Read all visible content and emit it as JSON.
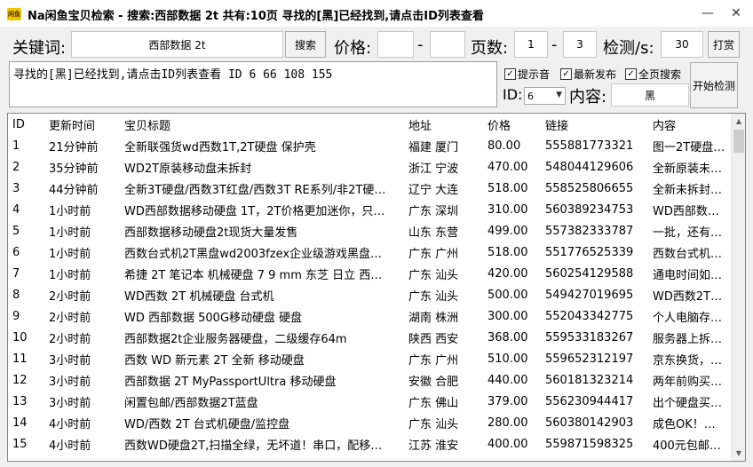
{
  "window": {
    "icon_label": "闲鱼",
    "title": "Na闲鱼宝贝检索 - 搜索:西部数据 2t 共有:10页 寻找的[黑]已经找到,请点击ID列表查看",
    "minimize_glyph": "—",
    "close_glyph": "✕"
  },
  "toolbar": {
    "keyword_label": "关键词:",
    "keyword_value": "西部数据 2t",
    "search_button": "搜索",
    "price_label": "价格:",
    "price_min": "",
    "price_dash": "-",
    "price_max": "",
    "pages_label": "页数:",
    "page_from": "1",
    "page_dash": "-",
    "page_to": "3",
    "interval_label": "检测/s:",
    "interval_value": "30",
    "reward_button": "打赏"
  },
  "message": "寻找的[黑]已经找到,请点击ID列表查看 ID 6 66 108 155",
  "options": {
    "sound": {
      "label": "提示音",
      "checked": true
    },
    "latest": {
      "label": "最新发布",
      "checked": true
    },
    "all_pages": {
      "label": "全页搜索",
      "checked": true
    }
  },
  "id_select": {
    "label": "ID:",
    "value": "6"
  },
  "content_filter": {
    "label": "内容:",
    "value": "黑"
  },
  "start_button": "开始检测",
  "table": {
    "headers": [
      "ID",
      "更新时间",
      "宝贝标题",
      "地址",
      "价格",
      "链接",
      "内容"
    ],
    "rows": [
      [
        "1",
        "21分钟前",
        "全新联强货wd西数1T,2T硬盘 保护壳",
        "福建 厦门",
        "80.00",
        "555881773321",
        "图一2T硬盘…"
      ],
      [
        "2",
        "35分钟前",
        "WD2T原装移动盘未拆封",
        "浙江 宁波",
        "470.00",
        "548044129606",
        "全新原装未…"
      ],
      [
        "3",
        "44分钟前",
        "全新3T硬盘/西数3T红盘/西数3T RE系列/非2T硬…",
        "辽宁 大连",
        "518.00",
        "558525806655",
        "全新未拆封…"
      ],
      [
        "4",
        "1小时前",
        "WD西部数据移动硬盘 1T，2T价格更加迷你，只…",
        "广东 深圳",
        "310.00",
        "560389234753",
        "WD西部数…"
      ],
      [
        "5",
        "1小时前",
        "西部数据移动硬盘2t现货大量发售",
        "山东 东营",
        "499.00",
        "557382333787",
        "一批，还有…"
      ],
      [
        "6",
        "1小时前",
        "西数台式机2T黑盘wd2003fzex企业级游戏黑盘…",
        "广东 广州",
        "518.00",
        "551776525339",
        "西数台式机…"
      ],
      [
        "7",
        "1小时前",
        "希捷 2T 笔记本 机械硬盘 7 9 mm 东芝 日立 西…",
        "广东 汕头",
        "420.00",
        "560254129588",
        "通电时间如…"
      ],
      [
        "8",
        "2小时前",
        "WD西数 2T 机械硬盘 台式机",
        "广东 汕头",
        "500.00",
        "549427019695",
        "WD西数2T…"
      ],
      [
        "9",
        "2小时前",
        "WD 西部数据 500G移动硬盘 硬盘",
        "湖南 株洲",
        "300.00",
        "552043342775",
        "个人电脑存…"
      ],
      [
        "10",
        "2小时前",
        "西部数据2t企业服务器硬盘，二级缓存64m",
        "陕西 西安",
        "368.00",
        "559533183267",
        "服务器上拆…"
      ],
      [
        "11",
        "3小时前",
        "西数 WD 新元素 2T 全新 移动硬盘",
        "广东 广州",
        "510.00",
        "559652312197",
        "京东换货，…"
      ],
      [
        "12",
        "3小时前",
        "西部数据 2T MyPassportUltra 移动硬盘",
        "安徽 合肥",
        "440.00",
        "560181323214",
        "两年前购买…"
      ],
      [
        "13",
        "3小时前",
        "闲置包邮/西部数据2T蓝盘",
        "广东 佛山",
        "379.00",
        "556230944417",
        "出个硬盘买…"
      ],
      [
        "14",
        "4小时前",
        "WD/西数 2T 台式机硬盘/监控盘",
        "广东 汕头",
        "280.00",
        "560380142903",
        "成色OK！…"
      ],
      [
        "15",
        "4小时前",
        "西数WD硬盘2T,扫描全绿，无坏道！串口，配移…",
        "江苏 淮安",
        "400.00",
        "559871598325",
        "400元包邮…"
      ]
    ]
  }
}
